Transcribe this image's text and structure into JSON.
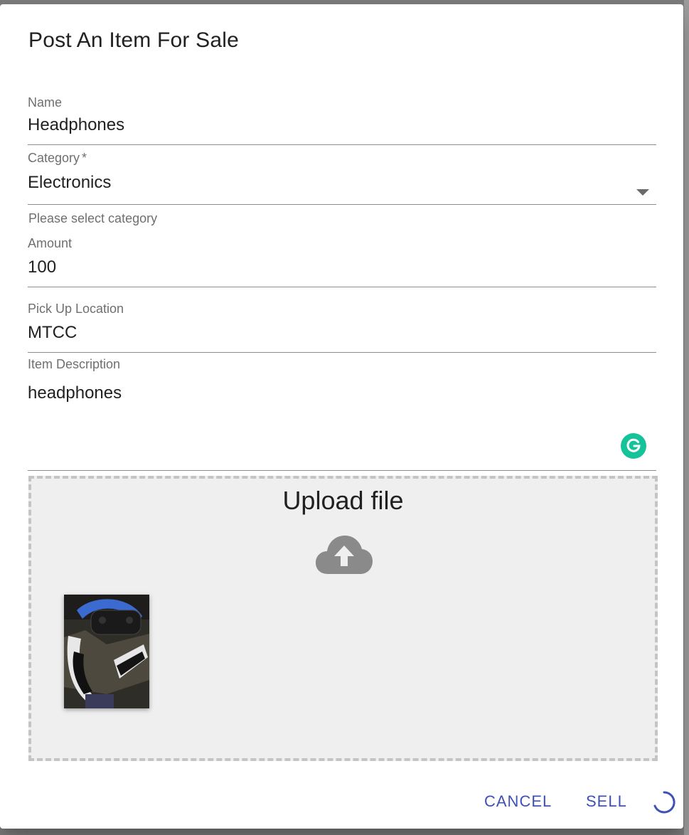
{
  "dialog": {
    "title": "Post An Item For Sale"
  },
  "fields": {
    "name": {
      "label": "Name",
      "value": "Headphones"
    },
    "category": {
      "label": "Category",
      "required_mark": "*",
      "value": "Electronics",
      "helper": "Please select category"
    },
    "amount": {
      "label": "Amount",
      "value": "100"
    },
    "pickup": {
      "label": "Pick Up Location",
      "value": "MTCC"
    },
    "description": {
      "label": "Item Description",
      "value": "headphones"
    }
  },
  "upload": {
    "title": "Upload file",
    "icon": "cloud-upload-icon"
  },
  "actions": {
    "cancel": "CANCEL",
    "sell": "SELL"
  },
  "colors": {
    "primary": "#3f51b5",
    "grammarly": "#15c39a",
    "dropzone_bg": "#efefef"
  }
}
